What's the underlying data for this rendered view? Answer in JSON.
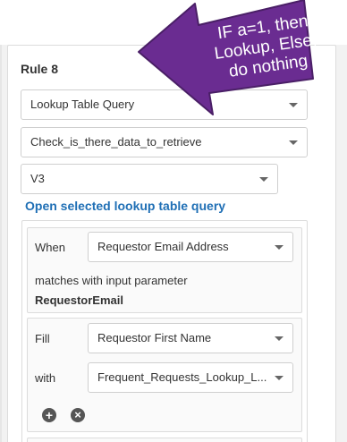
{
  "rule": {
    "title": "Rule 8"
  },
  "selects": {
    "query_type": "Lookup Table Query",
    "query_name": "Check_is_there_data_to_retrieve",
    "version": "V3"
  },
  "link": {
    "open_query": "Open selected lookup table query"
  },
  "when_block": {
    "when_label": "When",
    "when_value": "Requestor Email Address",
    "matches_text": "matches with input parameter",
    "param_name": "RequestorEmail"
  },
  "fill_block": {
    "fill_label": "Fill",
    "fill_value": "Requestor First Name",
    "with_label": "with",
    "with_value": "Frequent_Requests_Lookup_L..."
  },
  "icons": {
    "add": "+",
    "remove": "×"
  },
  "callout": {
    "text_line1": "IF a=1, then",
    "text_line2": "Lookup, Else,",
    "text_line3": "do nothing",
    "color": "#6a2c91"
  }
}
